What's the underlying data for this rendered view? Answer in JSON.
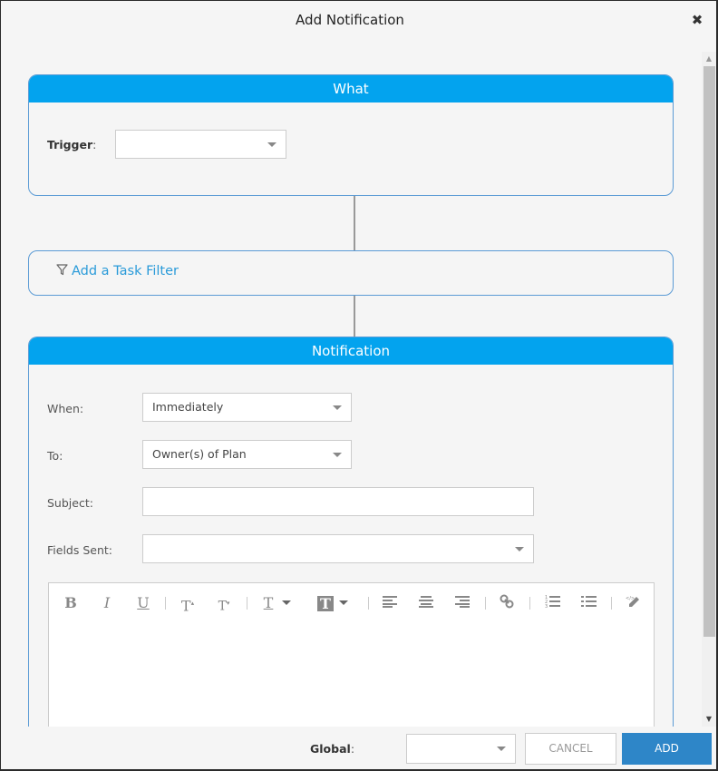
{
  "dialog": {
    "title": "Add Notification",
    "close_icon": "close-icon"
  },
  "what": {
    "header": "What",
    "trigger_label": "Trigger",
    "trigger_colon": ":",
    "trigger_value": ""
  },
  "filter": {
    "icon": "filter-icon",
    "label": "Add a Task Filter"
  },
  "notification": {
    "header": "Notification",
    "when_label": "When:",
    "when_value": "Immediately",
    "to_label": "To:",
    "to_value": "Owner(s) of Plan",
    "subject_label": "Subject:",
    "subject_value": "",
    "fields_label": "Fields Sent:",
    "fields_value": ""
  },
  "toolbar": {
    "bold": "B",
    "italic": "I",
    "underline": "U",
    "superscript": "T",
    "subscript": "T",
    "font_color": "T",
    "highlight": "T"
  },
  "footer": {
    "global_label": "Global",
    "global_colon": ":",
    "global_value": "",
    "cancel_label": "CANCEL",
    "add_label": "ADD"
  },
  "colors": {
    "header_blue": "#03a3ee",
    "border_blue": "#5b9bd5",
    "link_blue": "#2a9bd9",
    "primary_button": "#2e86c8"
  }
}
